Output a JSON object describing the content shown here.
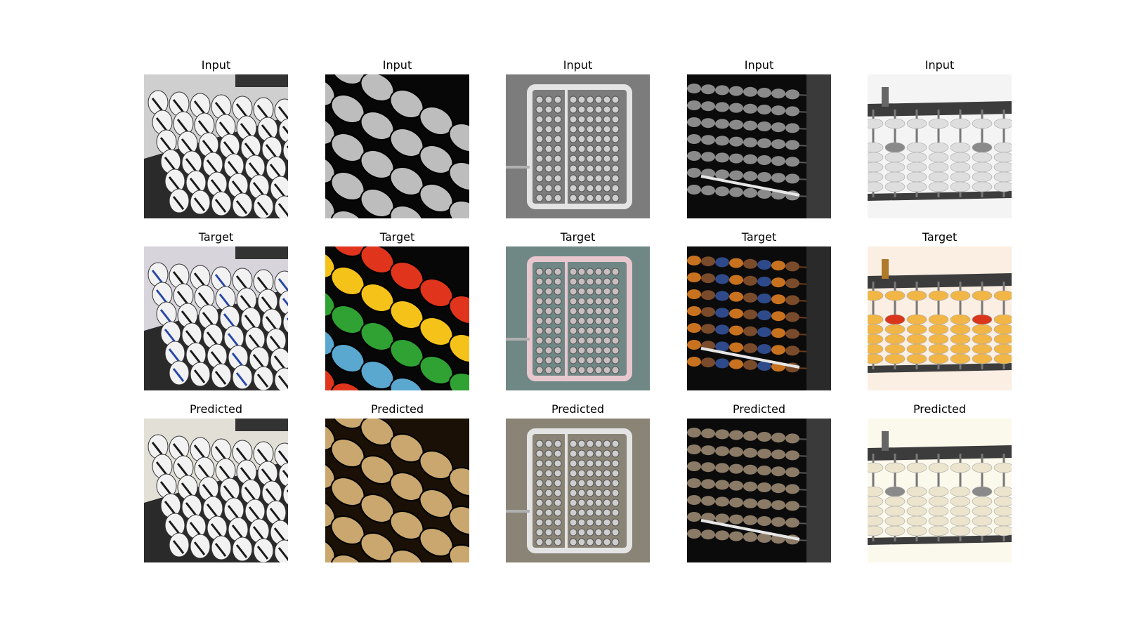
{
  "row_titles": [
    "Input",
    "Target",
    "Predicted"
  ],
  "columns": [
    {
      "subject": "ceramic-abacus-rows"
    },
    {
      "subject": "diagonal-bead-rows"
    },
    {
      "subject": "abacus-pendant"
    },
    {
      "subject": "abacus-closeup-perspective"
    },
    {
      "subject": "white-abacus-rods"
    }
  ],
  "palettes": {
    "Input": {
      "bg": "#555555",
      "light": "#dddddd",
      "dark": "#111111",
      "accent": "#9a9a9a"
    },
    "Target": {
      "bg": "#6f8f8a",
      "light": "#f1c070",
      "dark": "#1a1208",
      "accent": "#2e6fbf"
    },
    "Predicted": {
      "bg": "#6b5a40",
      "light": "#e8d6b0",
      "dark": "#1c140a",
      "accent": "#c9a46a"
    }
  },
  "target_bead_colors": [
    "#e0351c",
    "#f5c21a",
    "#2fa233",
    "#5aa7cf"
  ]
}
